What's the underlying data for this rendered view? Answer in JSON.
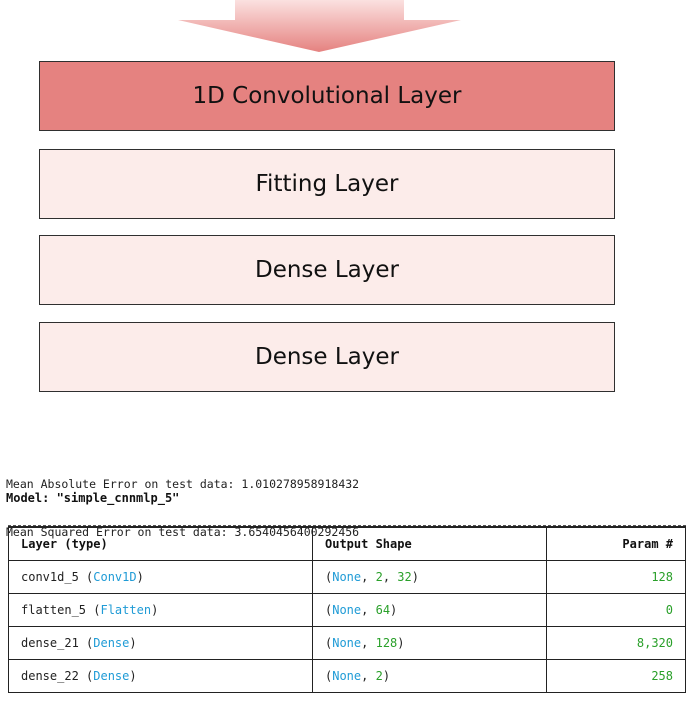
{
  "diagram": {
    "layers": [
      {
        "label": "1D Convolutional Layer",
        "style": "primary"
      },
      {
        "label": "Fitting Layer",
        "style": "light"
      },
      {
        "label": "Dense Layer",
        "style": "light"
      },
      {
        "label": "Dense Layer",
        "style": "light"
      }
    ],
    "colors": {
      "primary": "#e58280",
      "light": "#fcecea",
      "arrow": "#e58280"
    }
  },
  "console": {
    "mae_line": "Mean Absolute Error on test data: 1.010278958918432",
    "mse_line": "Mean Squared Error on test data: 3.6540456400292456",
    "model_title": "Model: \"simple_cnnmlp_5\""
  },
  "summary_table": {
    "headers": [
      "Layer (type)",
      "Output Shape",
      "Param #"
    ],
    "rows": [
      {
        "name": "conv1d_5",
        "type": "Conv1D",
        "shape_none": "None",
        "shape_rest": [
          "2",
          "32"
        ],
        "params": "128"
      },
      {
        "name": "flatten_5",
        "type": "Flatten",
        "shape_none": "None",
        "shape_rest": [
          "64"
        ],
        "params": "0"
      },
      {
        "name": "dense_21",
        "type": "Dense",
        "shape_none": "None",
        "shape_rest": [
          "128"
        ],
        "params": "8,320"
      },
      {
        "name": "dense_22",
        "type": "Dense",
        "shape_none": "None",
        "shape_rest": [
          "2"
        ],
        "params": "258"
      }
    ]
  }
}
